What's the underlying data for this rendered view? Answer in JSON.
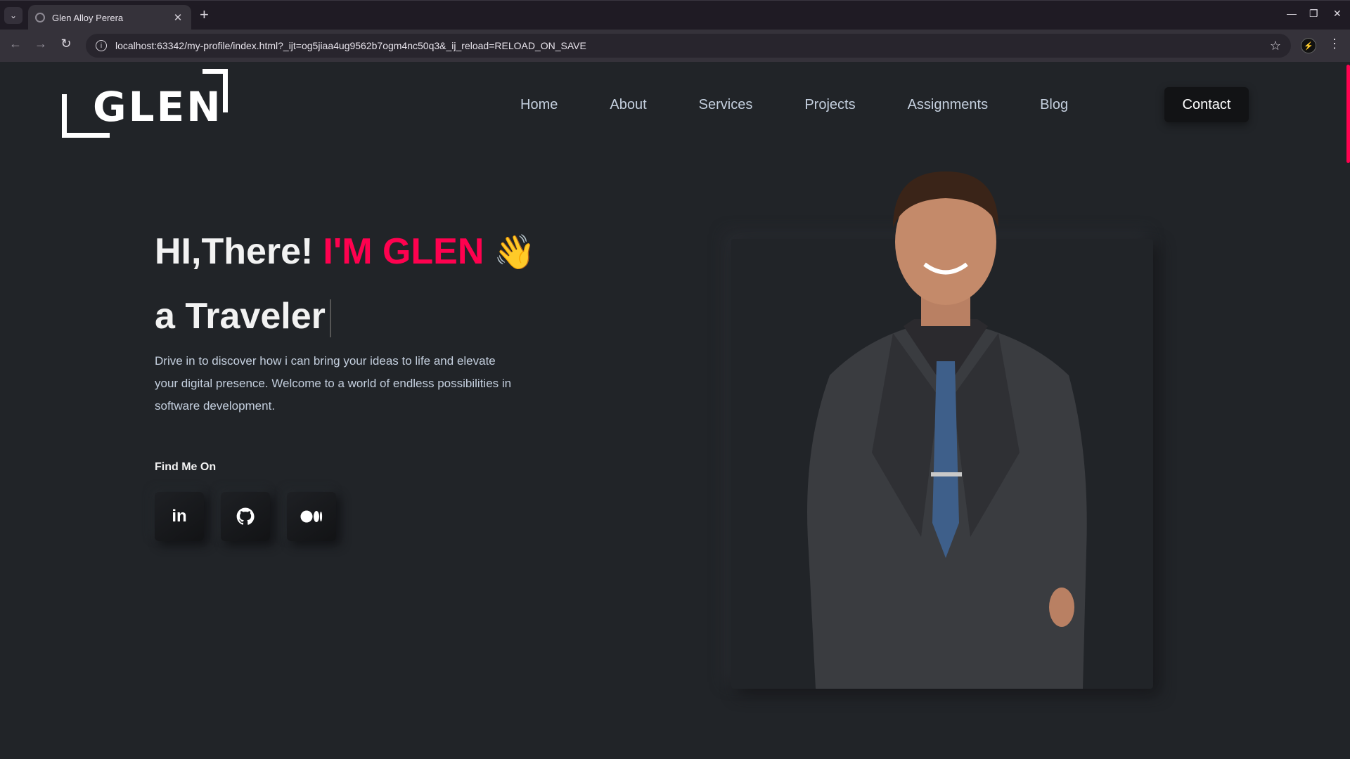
{
  "browser": {
    "tab_title": "Glen Alloy Perera",
    "url": "localhost:63342/my-profile/index.html?_ijt=og5jiaa4ug9562b7ogm4nc50q3&_ij_reload=RELOAD_ON_SAVE"
  },
  "site": {
    "logo_text": "GLEN",
    "nav": {
      "home": "Home",
      "about": "About",
      "services": "Services",
      "projects": "Projects",
      "assignments": "Assignments",
      "blog": "Blog",
      "contact": "Contact"
    },
    "hero": {
      "greeting": "HI,There!",
      "name": "I'M GLEN",
      "wave": "👋",
      "role": "a Traveler",
      "description": "Drive in to discover how i can bring your ideas to life and elevate your digital presence. Welcome to a world of endless possibilities in software development.",
      "find_me_on": "Find Me On"
    },
    "socials": {
      "linkedin": "in"
    },
    "colors": {
      "accent": "#ff014f",
      "background": "#212428",
      "text": "#c4cfde"
    }
  }
}
